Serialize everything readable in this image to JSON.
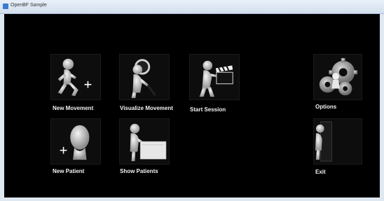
{
  "window": {
    "title": "OpenBF Sample"
  },
  "menu": {
    "new_movement": {
      "label": "New Movement",
      "icon": "running-figure-plus-icon"
    },
    "visualize_movement": {
      "label": "Visualize Movement",
      "icon": "figure-magnifier-icon"
    },
    "start_session": {
      "label": "Start Session",
      "icon": "figure-clapperboard-icon"
    },
    "options": {
      "label": "Options",
      "icon": "gears-icon"
    },
    "new_patient": {
      "label": "New Patient",
      "icon": "head-plus-icon"
    },
    "show_patients": {
      "label": "Show Patients",
      "icon": "figure-board-icon"
    },
    "exit": {
      "label": "Exit",
      "icon": "figure-door-icon"
    }
  }
}
